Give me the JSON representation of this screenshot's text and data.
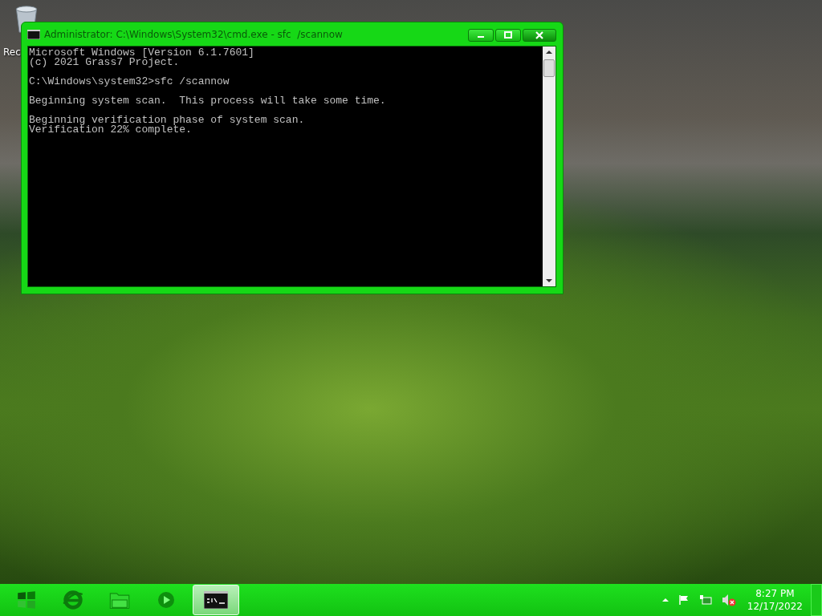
{
  "desktop": {
    "icons": [
      {
        "label": "Rec"
      }
    ]
  },
  "window": {
    "title": "Administrator: C:\\Windows\\System32\\cmd.exe - sfc  /scannow",
    "console": {
      "paragraphs": [
        [
          "Microsoft Windows [Version 6.1.7601]",
          "(c) 2021 Grass7 Project."
        ],
        [
          "C:\\Windows\\system32>sfc /scannow"
        ],
        [
          "Beginning system scan.  This process will take some time."
        ],
        [
          "Beginning verification phase of system scan.",
          "Verification 22% complete."
        ]
      ]
    }
  },
  "taskbar": {
    "buttons": [
      {
        "kind": "start",
        "selected": false
      },
      {
        "kind": "browser",
        "selected": false
      },
      {
        "kind": "folder",
        "selected": false
      },
      {
        "kind": "media",
        "selected": false
      },
      {
        "kind": "console",
        "selected": true
      }
    ],
    "tray": {
      "time": "8:27 PM",
      "date": "12/17/2022"
    }
  }
}
